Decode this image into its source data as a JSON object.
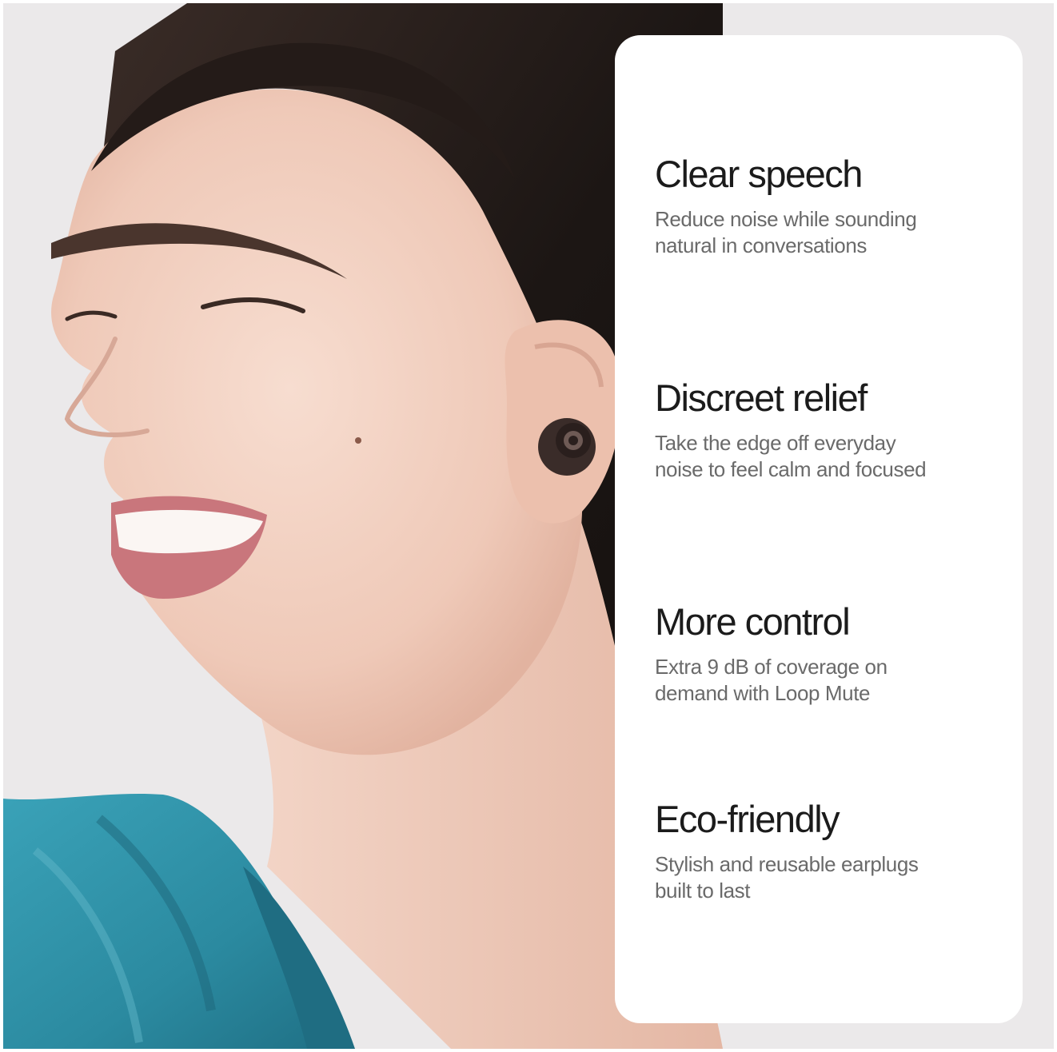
{
  "features": [
    {
      "title": "Clear speech",
      "description": "Reduce noise while sounding natural in conversations"
    },
    {
      "title": "Discreet relief",
      "description": "Take the edge off everyday noise to feel calm and focused"
    },
    {
      "title": "More control",
      "description": "Extra 9 dB of coverage on demand with Loop Mute"
    },
    {
      "title": "Eco-friendly",
      "description": "Stylish and reusable earplugs built to last"
    }
  ],
  "colors": {
    "background": "#ebe9ea",
    "panel": "#ffffff",
    "title": "#1b1b1b",
    "description": "#6a6a6a",
    "shirt": "#2f8fa6",
    "hair": "#1c1614",
    "skin": "#f1cfc0"
  }
}
